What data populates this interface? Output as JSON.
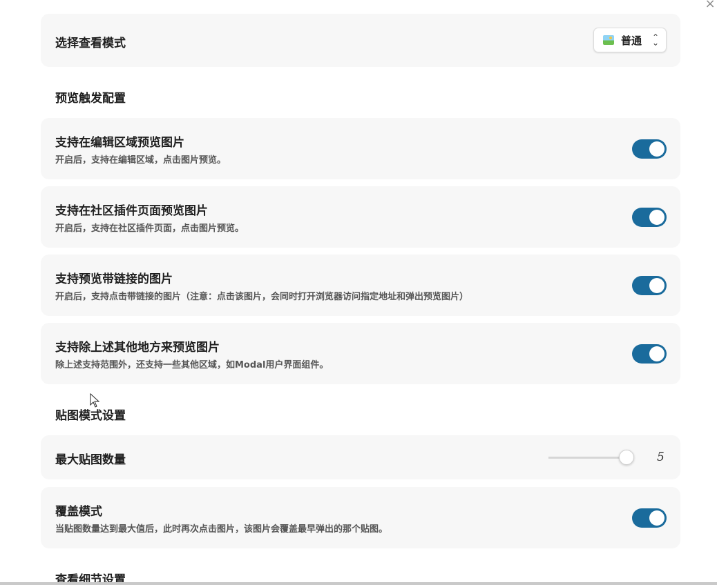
{
  "close_glyph": "×",
  "view_mode": {
    "label": "选择查看模式",
    "selected": "普通",
    "icon": "picture-icon"
  },
  "sections": {
    "preview_trigger": "预览触发配置",
    "sticker_mode": "贴图模式设置",
    "detail": "查看细节设置"
  },
  "options": {
    "edit_area": {
      "title": "支持在编辑区域预览图片",
      "desc": "开启后，支持在编辑区域，点击图片预览。",
      "enabled": true
    },
    "plugin_page": {
      "title": "支持在社区插件页面预览图片",
      "desc": "开启后，支持在社区插件页面，点击图片预览。",
      "enabled": true
    },
    "linked_image": {
      "title": "支持预览带链接的图片",
      "desc": "开启后，支持点击带链接的图片（注意：点击该图片，会同时打开浏览器访问指定地址和弹出预览图片）",
      "enabled": true
    },
    "other_places": {
      "title": "支持除上述其他地方来预览图片",
      "desc": "除上述支持范围外，还支持一些其他区域，如Modal用户界面组件。",
      "enabled": true
    },
    "max_stickers": {
      "title": "最大贴图数量",
      "value": "5",
      "fraction": 0.94
    },
    "overwrite_mode": {
      "title": "覆盖模式",
      "desc": "当贴图数量达到最大值后，此时再次点击图片，该图片会覆盖最早弹出的那个贴图。",
      "enabled": true
    }
  },
  "colors": {
    "toggle_on": "#1a6b9c",
    "card_bg": "#f7f7f7"
  }
}
